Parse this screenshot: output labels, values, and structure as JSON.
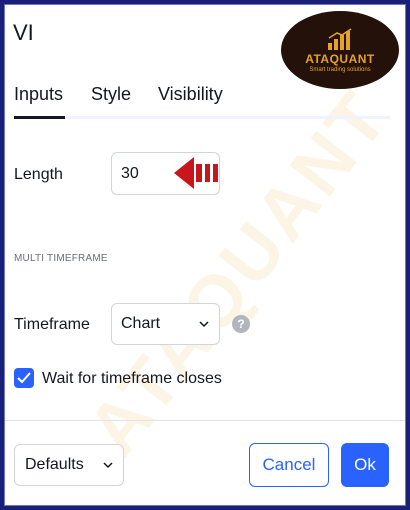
{
  "dialog": {
    "title": "VI"
  },
  "logo": {
    "brand": "ATAQUANT",
    "tagline": "Smart trading solutions"
  },
  "tabs": [
    {
      "label": "Inputs",
      "active": true
    },
    {
      "label": "Style",
      "active": false
    },
    {
      "label": "Visibility",
      "active": false
    }
  ],
  "inputs": {
    "length_label": "Length",
    "length_value": "30",
    "section_title": "MULTI TIMEFRAME",
    "timeframe_label": "Timeframe",
    "timeframe_value": "Chart",
    "help_symbol": "?",
    "wait_checkbox_label": "Wait for timeframe closes",
    "wait_checked": true
  },
  "footer": {
    "defaults_label": "Defaults",
    "cancel_label": "Cancel",
    "ok_label": "Ok"
  },
  "colors": {
    "accent": "#2962ff",
    "arrow": "#c8161d",
    "frame": "#1a1f78",
    "logo_bg": "#24120a",
    "logo_gold": "#e4a22a"
  }
}
